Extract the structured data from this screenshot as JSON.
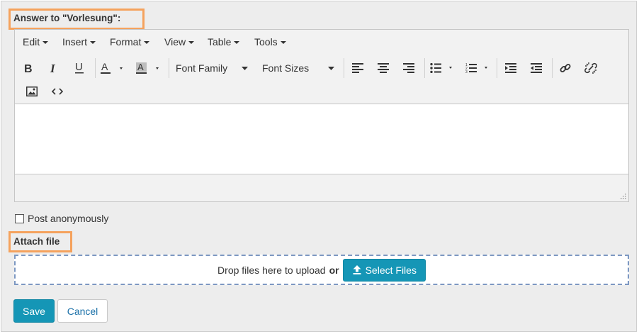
{
  "answer_section": {
    "title": "Answer to \"Vorlesung\":"
  },
  "editor": {
    "menu": [
      "Edit",
      "Insert",
      "Format",
      "View",
      "Table",
      "Tools"
    ],
    "font_family_label": "Font Family",
    "font_sizes_label": "Font Sizes"
  },
  "post_anonymously": {
    "label": "Post anonymously",
    "checked": false
  },
  "attach_section": {
    "title": "Attach file"
  },
  "dropzone": {
    "text": "Drop files here to upload",
    "or": "or",
    "select_button": "Select Files"
  },
  "actions": {
    "save": "Save",
    "cancel": "Cancel"
  },
  "colors": {
    "highlight": "#f5a25d",
    "primary": "#1596b6",
    "link": "#1a70a8",
    "dropzone_border": "#7d98c2"
  },
  "icons": [
    "bold-icon",
    "italic-icon",
    "underline-icon",
    "text-color-icon",
    "background-color-icon",
    "align-left-icon",
    "align-center-icon",
    "align-right-icon",
    "bullet-list-icon",
    "numbered-list-icon",
    "outdent-icon",
    "indent-icon",
    "link-icon",
    "unlink-icon",
    "image-icon",
    "source-code-icon",
    "upload-icon"
  ]
}
